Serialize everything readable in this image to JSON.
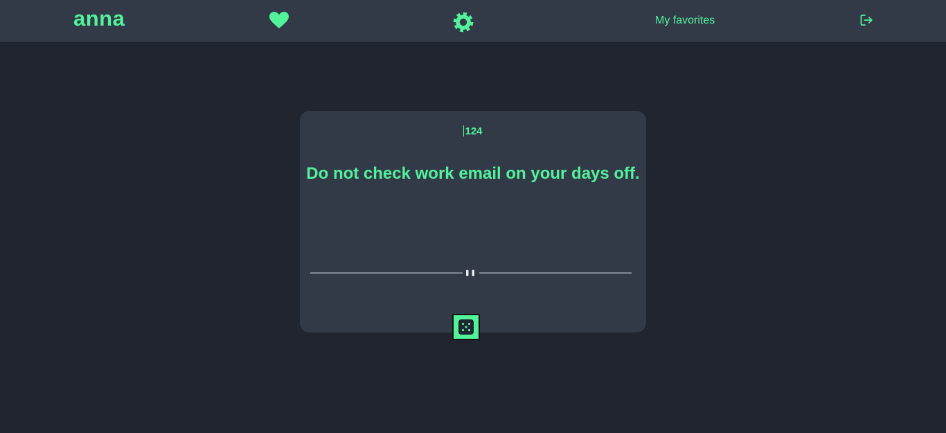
{
  "header": {
    "brand": "anna",
    "favorites_link": "My favorites",
    "icons": [
      "heart-icon",
      "gear-icon",
      "logout-icon"
    ]
  },
  "advice": {
    "id": "124",
    "text": "Do not check work email on your days off."
  },
  "controls": {
    "new_advice_icon": "dice-icon"
  },
  "colors": {
    "background": "#202530",
    "surface": "#323a48",
    "accent": "#52f29b",
    "divider": "#cfd6e0"
  }
}
